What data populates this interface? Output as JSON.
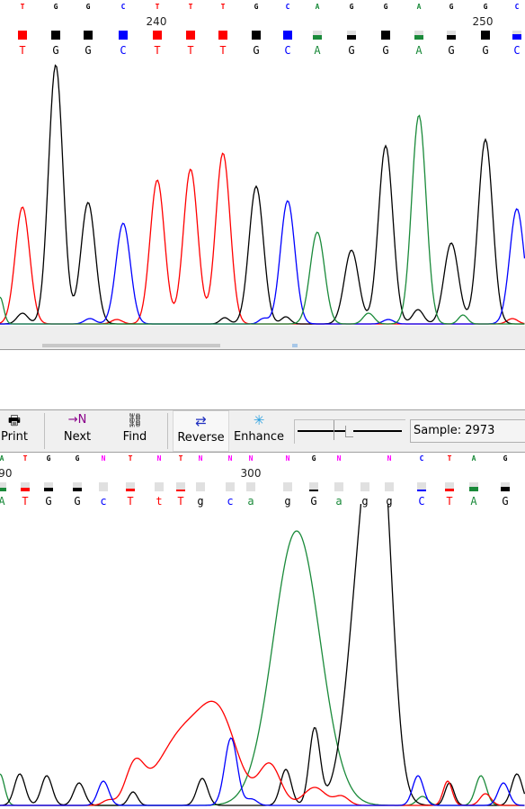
{
  "colors": {
    "A": "#1a8a3a",
    "C": "#0000ff",
    "G": "#000000",
    "T": "#ff0000",
    "N": "#ff00ff"
  },
  "top_panel": {
    "raw_calls": [
      "T",
      "G",
      "G",
      "C",
      "T",
      "T",
      "T",
      "G",
      "C",
      "A",
      "G",
      "G",
      "A",
      "G",
      "G",
      "C"
    ],
    "ruler": [
      {
        "label": "240"
      },
      {
        "label": "250"
      }
    ],
    "quality": [
      1,
      1,
      1,
      1,
      1,
      1,
      1,
      1,
      1,
      0.5,
      0.5,
      1,
      0.5,
      0.5,
      1,
      0.6
    ],
    "calls": [
      "T",
      "G",
      "G",
      "C",
      "T",
      "T",
      "T",
      "G",
      "C",
      "A",
      "G",
      "G",
      "A",
      "G",
      "G",
      "C"
    ]
  },
  "toolbar": {
    "print": "Print",
    "next": "Next",
    "find": "Find",
    "reverse": "Reverse",
    "enhance": "Enhance",
    "sample": "Sample: 2973",
    "slider_level": 0.5
  },
  "bottom_panel": {
    "raw_calls": [
      "A",
      "T",
      "G",
      "G",
      "N",
      "T",
      "N",
      "T",
      "N",
      "N",
      "N",
      "N",
      "G",
      "N",
      "",
      "N",
      "C",
      "T",
      "A",
      "G"
    ],
    "ruler": [
      {
        "label": "290"
      },
      {
        "label": "300"
      }
    ],
    "quality": [
      0.4,
      0.4,
      0.4,
      0.4,
      0,
      0.3,
      0,
      0.2,
      0,
      0,
      0,
      0,
      0.2,
      0,
      0,
      0,
      0.2,
      0.3,
      0.5,
      0.5
    ],
    "calls": [
      "A",
      "T",
      "G",
      "G",
      "c",
      "T",
      "t",
      "T",
      "g",
      "c",
      "a",
      "g",
      "G",
      "a",
      "g",
      "g",
      "C",
      "T",
      "A",
      "G"
    ]
  }
}
